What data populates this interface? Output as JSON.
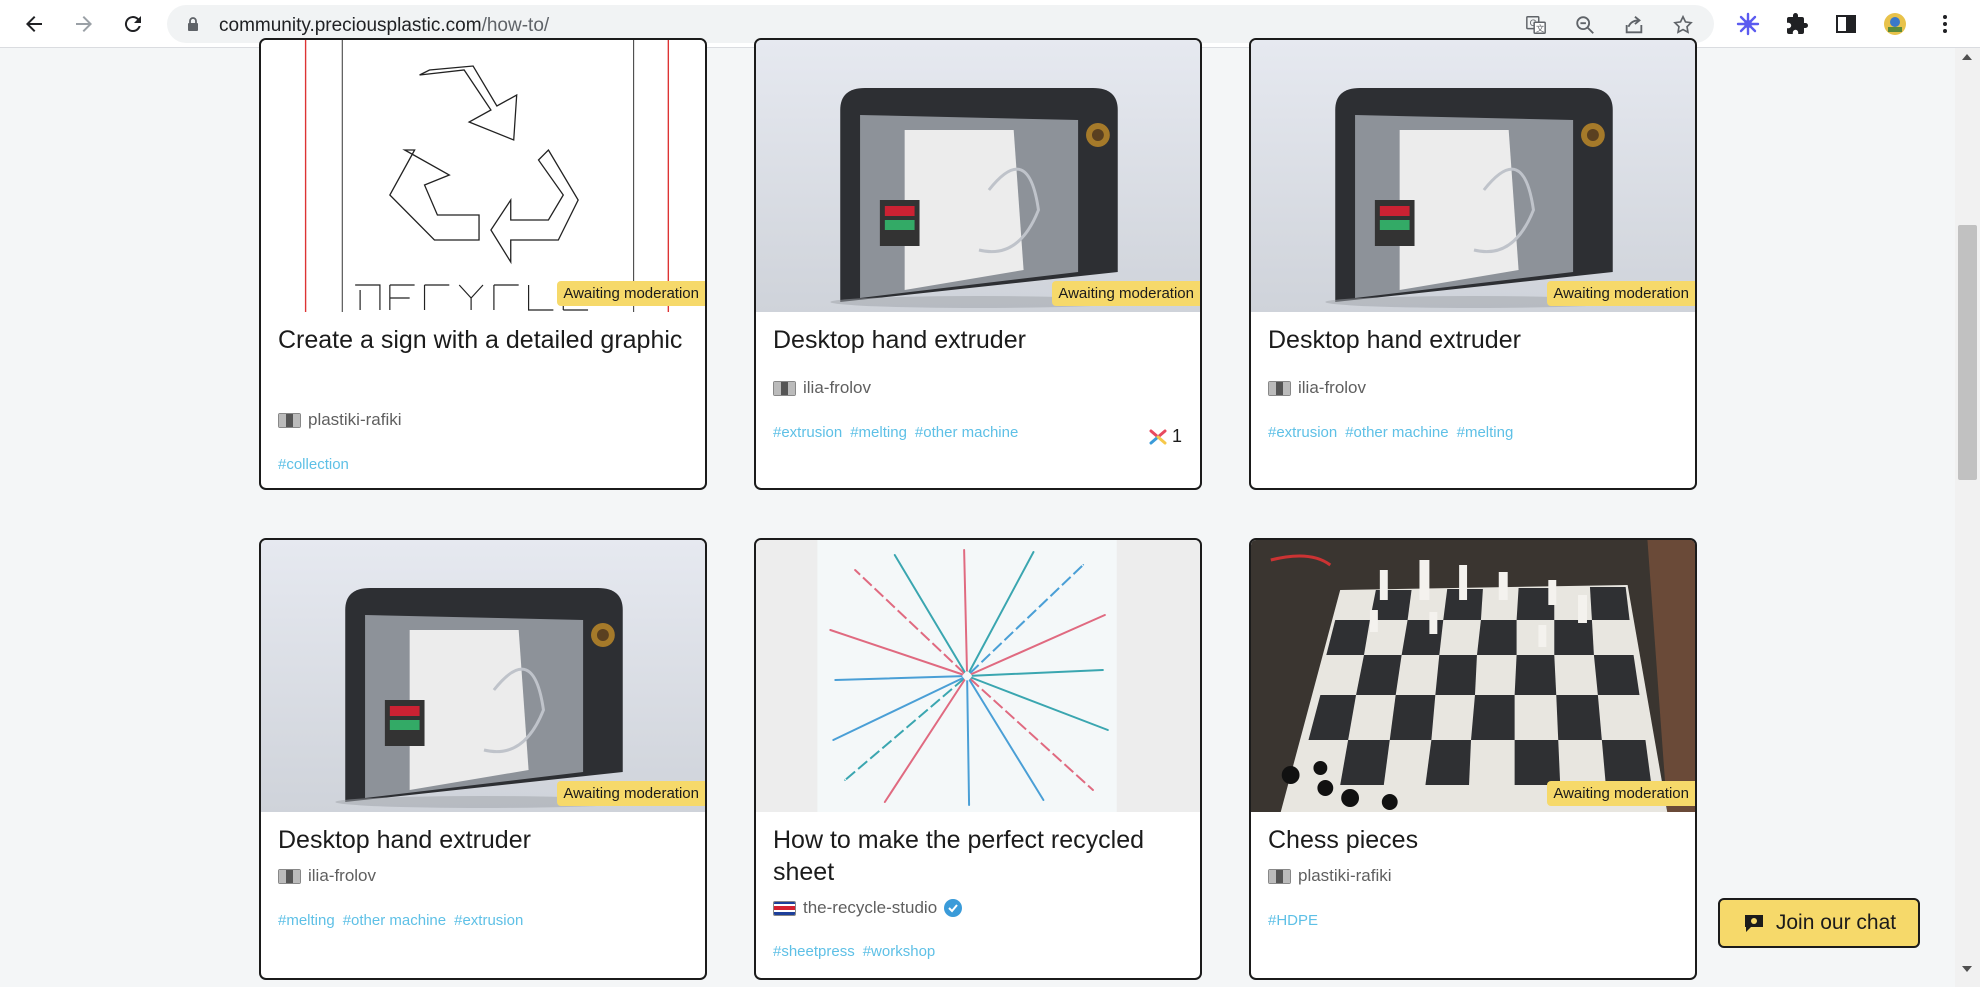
{
  "browser": {
    "url_domain": "community.preciousplastic.com",
    "url_path": "/how-to/"
  },
  "cards": [
    {
      "title": "Create a sign with a detailed graphic",
      "badge": "Awaiting moderation",
      "author": "plastiki-rafiki",
      "tags": [
        "#collection"
      ]
    },
    {
      "title": "Desktop hand extruder",
      "badge": "Awaiting moderation",
      "author": "ilia-frolov",
      "tags": [
        "#extrusion",
        "#melting",
        "#other machine"
      ],
      "useful_count": "1"
    },
    {
      "title": "Desktop hand extruder",
      "badge": "Awaiting moderation",
      "author": "ilia-frolov",
      "tags": [
        "#extrusion",
        "#other machine",
        "#melting"
      ]
    },
    {
      "title": "Desktop hand extruder",
      "badge": "Awaiting moderation",
      "author": "ilia-frolov",
      "tags": [
        "#melting",
        "#other machine",
        "#extrusion"
      ]
    },
    {
      "title": "How to make the perfect recycled sheet",
      "author": "the-recycle-studio",
      "tags": [
        "#sheetpress",
        "#workshop"
      ]
    },
    {
      "title": "Chess pieces",
      "badge": "Awaiting moderation",
      "author": "plastiki-rafiki",
      "tags": [
        "#HDPE"
      ]
    }
  ],
  "chat": {
    "label": "Join our chat"
  },
  "icons": [
    "back-icon",
    "forward-icon",
    "reload-icon",
    "lock-icon",
    "translate-icon",
    "zoom-out-icon",
    "share-icon",
    "star-icon",
    "extension-icon",
    "puzzle-icon",
    "side-panel-icon",
    "profile-icon",
    "menu-icon",
    "chat-icon",
    "verified-icon",
    "useful-icon"
  ],
  "colors": {
    "badge": "#f6d96a",
    "tag": "#5ec0e6",
    "card_border": "#1b1b1b",
    "page_bg": "#f4f6f7"
  }
}
